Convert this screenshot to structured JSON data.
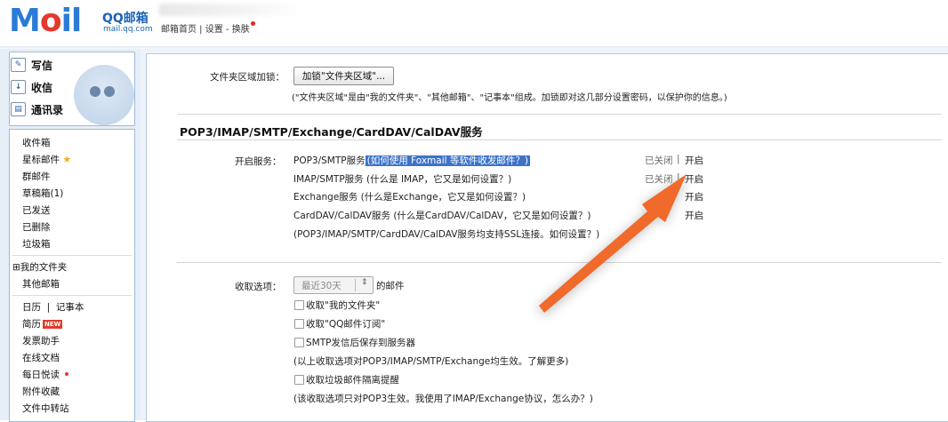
{
  "header": {
    "logo_part1": "M",
    "logo_part2": "o",
    "logo_part3": "il",
    "logo_qq": "QQ邮箱",
    "logo_domain": "mail.qq.com",
    "top_links": "邮箱首页 | 设置 - 换肤"
  },
  "leftnav": {
    "compose": "写信",
    "inbox": "收信",
    "contacts": "通讯录",
    "folders": [
      {
        "label": "收件箱"
      },
      {
        "label": "星标邮件"
      },
      {
        "label": "群邮件"
      },
      {
        "label": "草稿箱(1)"
      },
      {
        "label": "已发送"
      },
      {
        "label": "已删除"
      },
      {
        "label": "垃圾箱"
      }
    ],
    "my_folders": "⊞我的文件夹",
    "other_mailbox": "其他邮箱",
    "calendar": "日历",
    "notes": "记事本",
    "resume": "简历",
    "new_badge": "NEW",
    "invoice": "发票助手",
    "online_docs": "在线文档",
    "daily_reading": "每日悦读",
    "attachments": "附件收藏",
    "file_transfer": "文件中转站"
  },
  "main": {
    "folder_lock_label": "文件夹区域加锁：",
    "folder_lock_button": "加锁\"文件夹区域\"...",
    "folder_lock_note": "(\"文件夹区域\"是由\"我的文件夹\"、\"其他邮箱\"、\"记事本\"组成。加锁即对这几部分设置密码，以保护你的信息。)",
    "section_title": "POP3/IMAP/SMTP/Exchange/CardDAV/CalDAV服务",
    "enable_label": "开启服务：",
    "services": [
      {
        "name": "POP3/SMTP服务",
        "hint": "(如何使用 Foxmail 等软件收发邮件？)",
        "status": "已关闭",
        "action": "开启"
      },
      {
        "name": "IMAP/SMTP服务",
        "hint": "(什么是 IMAP，它又是如何设置？)",
        "status": "已关闭",
        "action": "开启"
      },
      {
        "name": "Exchange服务",
        "hint": "(什么是Exchange，它又是如何设置？)",
        "status": "",
        "action": "开启"
      },
      {
        "name": "CardDAV/CalDAV服务",
        "hint": "(什么是CardDAV/CalDAV，它又是如何设置？)",
        "status": "",
        "action": "开启"
      }
    ],
    "status_sep": "|",
    "ssl_note": "(POP3/IMAP/SMTP/CardDAV/CalDAV服务均支持SSL连接。如何设置？)",
    "receive_label": "收取选项：",
    "receive_select": "最近30天",
    "receive_select_arrow": "⇕",
    "receive_suffix": "的邮件",
    "checkboxes": [
      {
        "label": "收取\"我的文件夹\""
      },
      {
        "label": "收取\"QQ邮件订阅\""
      },
      {
        "label": "SMTP发信后保存到服务器"
      }
    ],
    "note_1": "(以上收取选项对POP3/IMAP/SMTP/Exchange均生效。了解更多)",
    "checkbox_spam": "收取垃圾邮件隔离提醒",
    "note_2": "(该收取选项只对POP3生效。我使用了IMAP/Exchange协议，怎么办？)"
  },
  "colors": {
    "accent_blue": "#2b7bd6",
    "logo_red": "#e3392e",
    "arrow_orange": "#f06a2b",
    "highlight_blue": "#3c73c8"
  },
  "icons": [
    "compose-icon",
    "inbox-icon",
    "contacts-icon",
    "star-icon",
    "annotation-arrow"
  ]
}
